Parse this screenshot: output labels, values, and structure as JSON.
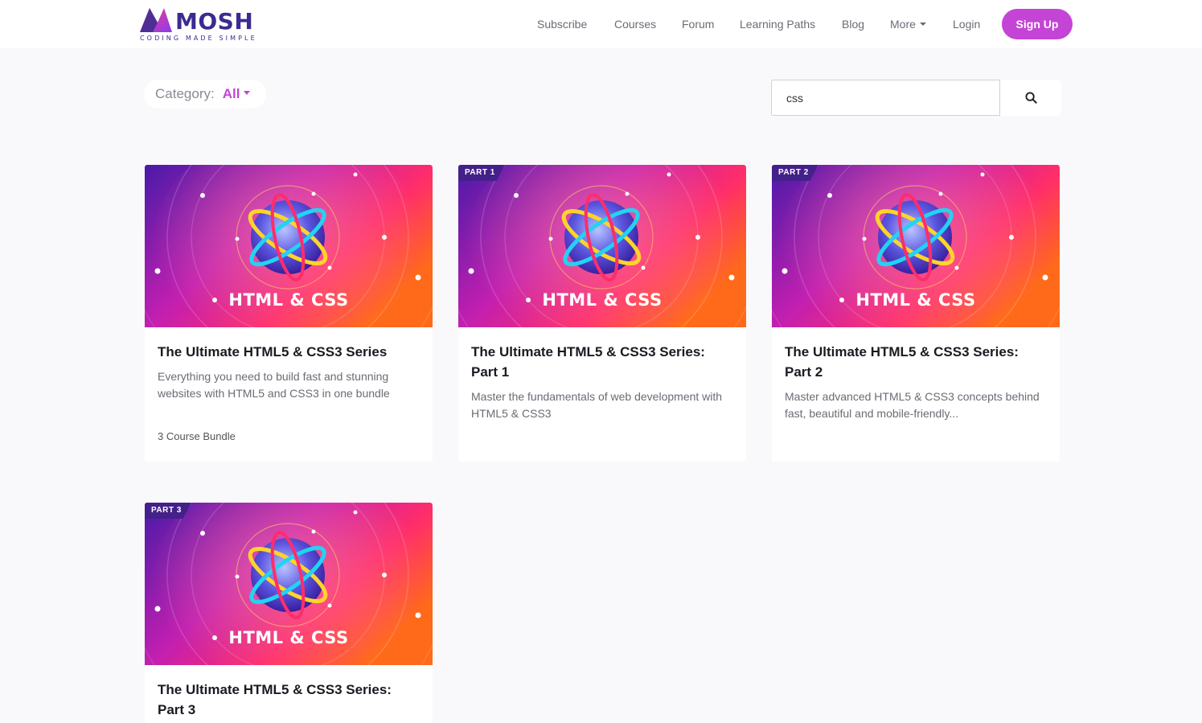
{
  "header": {
    "logo_word": "MOSH",
    "logo_tagline": "CODING MADE SIMPLE",
    "nav": [
      {
        "label": "Subscribe"
      },
      {
        "label": "Courses"
      },
      {
        "label": "Forum"
      },
      {
        "label": "Learning Paths"
      },
      {
        "label": "Blog"
      },
      {
        "label": "More"
      },
      {
        "label": "Login"
      }
    ],
    "signup_label": "Sign Up"
  },
  "filters": {
    "category_label": "Category:",
    "category_value": "All",
    "search_value": "css"
  },
  "cards": [
    {
      "thumb_text": "HTML & CSS",
      "badge": "",
      "title": "The Ultimate HTML5 & CSS3 Series",
      "description": "Everything you need to build fast and stunning websites with HTML5 and CSS3 in one bundle",
      "meta": "3 Course Bundle"
    },
    {
      "thumb_text": "HTML & CSS",
      "badge": "PART 1",
      "title": "The Ultimate HTML5 & CSS3 Series: Part 1",
      "description": "Master the fundamentals of web development with HTML5 & CSS3",
      "meta": ""
    },
    {
      "thumb_text": "HTML & CSS",
      "badge": "PART 2",
      "title": "The Ultimate HTML5 & CSS3 Series: Part 2",
      "description": "Master advanced HTML5 & CSS3 concepts behind fast, beautiful and mobile-friendly...",
      "meta": ""
    },
    {
      "thumb_text": "HTML & CSS",
      "badge": "PART 3",
      "title": "The Ultimate HTML5 & CSS3 Series: Part 3",
      "description": "",
      "meta": ""
    }
  ],
  "colors": {
    "accent": "#c444d6",
    "brand_dark": "#3a2c8f",
    "badge_bg": "#44208a"
  },
  "icons": {
    "search": "search-icon",
    "logo": "mosh-logo-icon"
  }
}
